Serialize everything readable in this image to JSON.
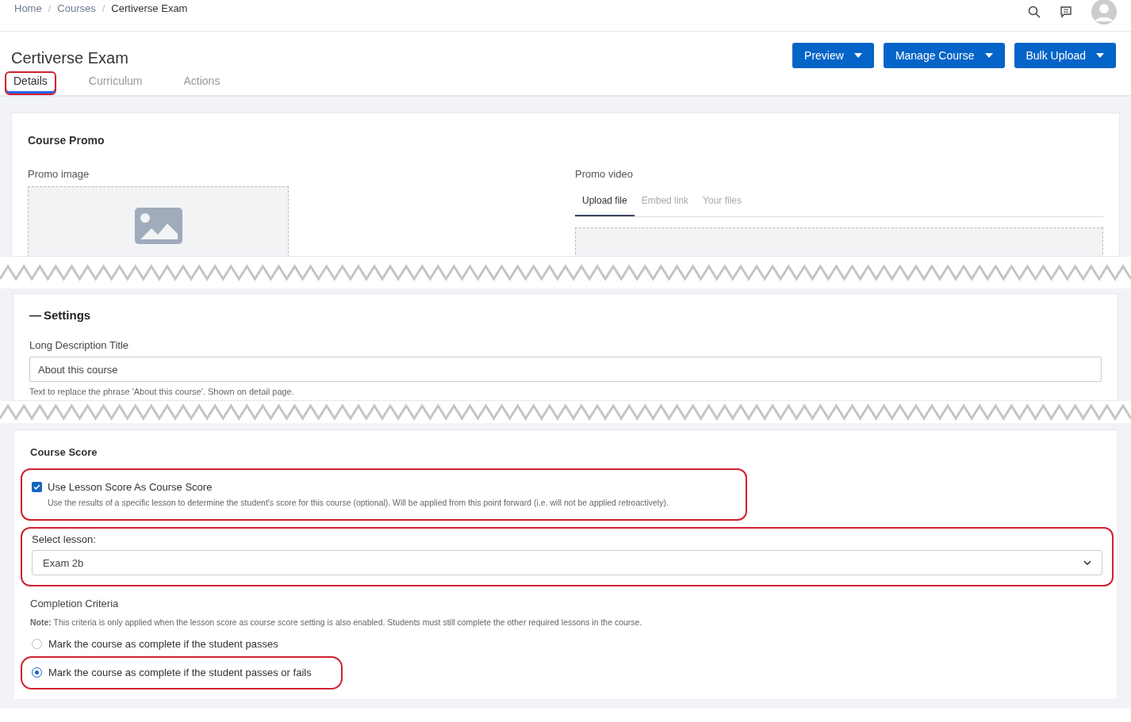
{
  "breadcrumb": [
    {
      "label": "Home",
      "current": false
    },
    {
      "label": "Courses",
      "current": false
    },
    {
      "label": "Certiverse Exam",
      "current": true
    }
  ],
  "breadcrumb_separator": "/",
  "page_title": "Certiverse Exam",
  "header_buttons": [
    "Preview",
    "Manage Course",
    "Bulk Upload"
  ],
  "tabs": [
    {
      "label": "Details",
      "selected": true
    },
    {
      "label": "Curriculum",
      "selected": false
    },
    {
      "label": "Actions",
      "selected": false
    }
  ],
  "course_promo": {
    "title": "Course Promo",
    "image_label": "Promo image",
    "video_label": "Promo video",
    "video_tabs": [
      {
        "label": "Upload file",
        "selected": true
      },
      {
        "label": "Embed link",
        "selected": false
      },
      {
        "label": "Your files",
        "selected": false
      }
    ]
  },
  "settings": {
    "toggle": "—",
    "title": "Settings",
    "field_label": "Long Description Title",
    "field_value": "About this course",
    "help": "Text to replace the phrase 'About this course'. Shown on detail page."
  },
  "course_score": {
    "title": "Course Score",
    "checkbox": {
      "label": "Use Lesson Score As Course Score",
      "checked": true,
      "help": "Use the results of a specific lesson to determine the student's score for this course (optional). Will be applied from this point forward (i.e. will not be applied retroactively)."
    },
    "select_label": "Select lesson:",
    "select_value": "Exam 2b",
    "criteria_title": "Completion Criteria",
    "note": "**Note:** This criteria is only applied when the lesson score as course score setting is also enabled. Students must still complete the other required lessons in the course.",
    "options": [
      {
        "label": "Mark the course as complete if the student passes",
        "selected": false
      },
      {
        "label": "Mark the course as complete if the student passes or fails",
        "selected": true
      }
    ]
  }
}
